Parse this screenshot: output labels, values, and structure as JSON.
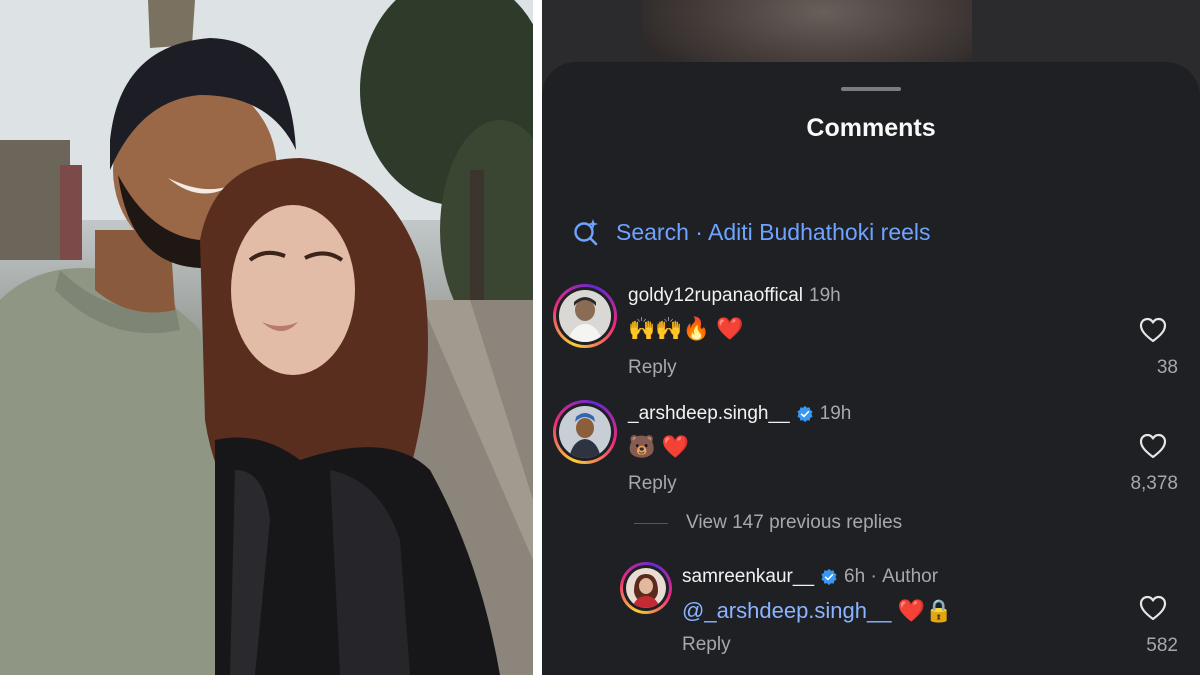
{
  "sheet": {
    "title": "Comments",
    "search_label": "Search · Aditi Budhathoki reels"
  },
  "comments": [
    {
      "username": "goldy12rupanaoffical",
      "time": "19h",
      "text": "🙌🙌🔥 ❤️",
      "reply_label": "Reply",
      "likes": "38",
      "verified": false
    },
    {
      "username": "_arshdeep.singh__",
      "time": "19h",
      "text": "🐻 ❤️",
      "reply_label": "Reply",
      "likes": "8,378",
      "verified": true
    }
  ],
  "view_previous_replies": "View 147 previous replies",
  "reply": {
    "username": "samreenkaur__",
    "time": "6h",
    "author_tag": "Author",
    "mention": "@_arshdeep.singh__",
    "text_after": "❤️🔒",
    "reply_label": "Reply",
    "likes": "582",
    "verified": true
  },
  "colors": {
    "sheet_bg": "#1f2023",
    "link_blue": "#6ea3ff",
    "verified_blue": "#3897f0",
    "muted_text": "#a7a8ab"
  },
  "icons": [
    "search-sparkle-icon",
    "heart-outline-icon",
    "verified-badge-icon"
  ]
}
